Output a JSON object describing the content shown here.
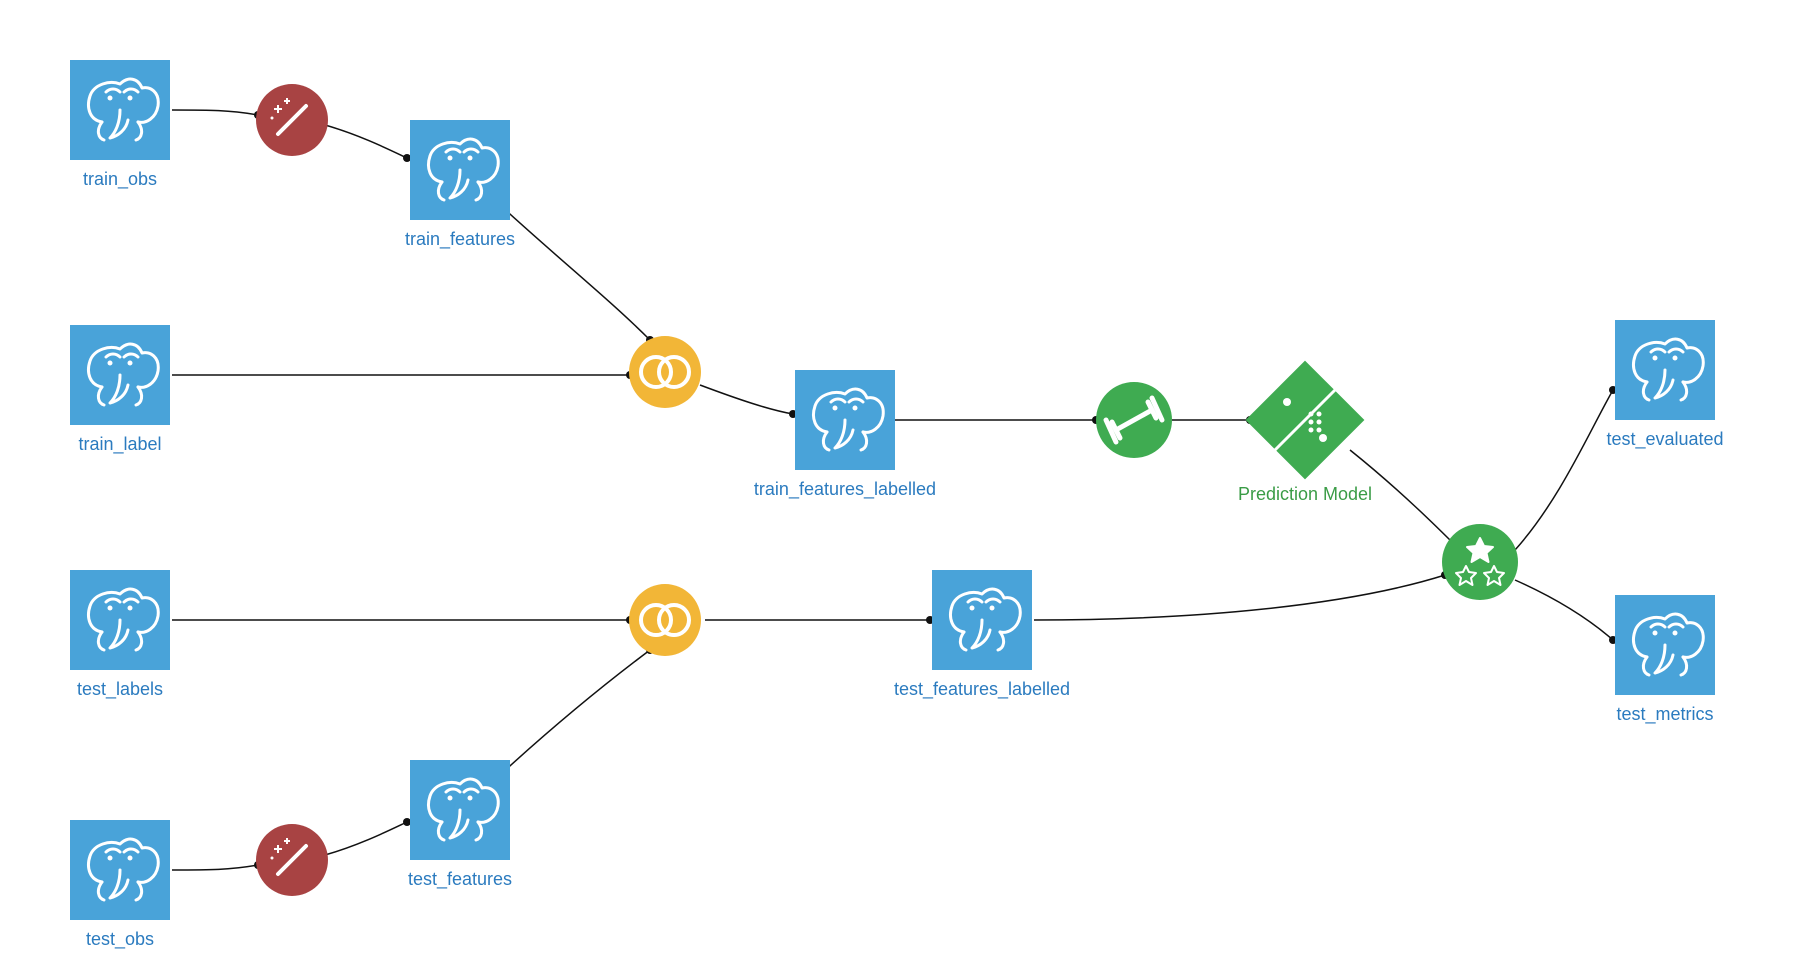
{
  "colors": {
    "db_box": "#49a3d9",
    "magic_wand": "#a84343",
    "join": "#f2b637",
    "train": "#3fab51",
    "model": "#3fab51",
    "evaluate": "#3fab51",
    "label_db": "#2b7bbf",
    "label_model": "#3a9c46"
  },
  "nodes": {
    "train_obs": {
      "type": "db",
      "label": "train_obs"
    },
    "train_label": {
      "type": "db",
      "label": "train_label"
    },
    "train_features": {
      "type": "db",
      "label": "train_features"
    },
    "train_features_labelled": {
      "type": "db",
      "label": "train_features_labelled"
    },
    "test_obs": {
      "type": "db",
      "label": "test_obs"
    },
    "test_labels": {
      "type": "db",
      "label": "test_labels"
    },
    "test_features": {
      "type": "db",
      "label": "test_features"
    },
    "test_features_labelled": {
      "type": "db",
      "label": "test_features_labelled"
    },
    "test_evaluated": {
      "type": "db",
      "label": "test_evaluated"
    },
    "test_metrics": {
      "type": "db",
      "label": "test_metrics"
    },
    "magic1": {
      "type": "magic",
      "label": ""
    },
    "magic2": {
      "type": "magic",
      "label": ""
    },
    "join1": {
      "type": "join",
      "label": ""
    },
    "join2": {
      "type": "join",
      "label": ""
    },
    "train_op": {
      "type": "train",
      "label": ""
    },
    "model": {
      "type": "model",
      "label": "Prediction Model"
    },
    "evaluate": {
      "type": "evaluate",
      "label": ""
    }
  },
  "edges": [
    [
      "train_obs",
      "magic1"
    ],
    [
      "magic1",
      "train_features"
    ],
    [
      "train_features",
      "join1"
    ],
    [
      "train_label",
      "join1"
    ],
    [
      "join1",
      "train_features_labelled"
    ],
    [
      "train_features_labelled",
      "train_op"
    ],
    [
      "train_op",
      "model"
    ],
    [
      "model",
      "evaluate"
    ],
    [
      "test_obs",
      "magic2"
    ],
    [
      "magic2",
      "test_features"
    ],
    [
      "test_features",
      "join2"
    ],
    [
      "test_labels",
      "join2"
    ],
    [
      "join2",
      "test_features_labelled"
    ],
    [
      "test_features_labelled",
      "evaluate"
    ],
    [
      "evaluate",
      "test_evaluated"
    ],
    [
      "evaluate",
      "test_metrics"
    ]
  ]
}
